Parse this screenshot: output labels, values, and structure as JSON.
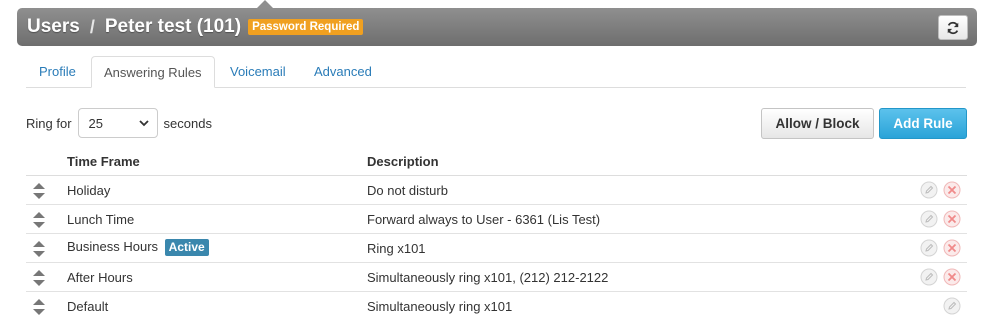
{
  "header": {
    "section": "Users",
    "separator": "/",
    "user_title": "Peter test (101)",
    "status_badge": "Password Required"
  },
  "tabs": [
    {
      "label": "Profile",
      "active": false
    },
    {
      "label": "Answering Rules",
      "active": true
    },
    {
      "label": "Voicemail",
      "active": false
    },
    {
      "label": "Advanced",
      "active": false
    }
  ],
  "ring_for": {
    "label": "Ring for",
    "value": "25",
    "suffix": "seconds"
  },
  "buttons": {
    "allow_block": "Allow / Block",
    "add_rule": "Add Rule"
  },
  "table": {
    "columns": [
      "Time Frame",
      "Description"
    ],
    "rows": [
      {
        "time_frame": "Holiday",
        "description": "Do not disturb",
        "active": false,
        "deletable": true
      },
      {
        "time_frame": "Lunch Time",
        "description": "Forward always to User - 6361 (Lis Test)",
        "active": false,
        "deletable": true
      },
      {
        "time_frame": "Business Hours",
        "description": "Ring x101",
        "active": true,
        "active_label": "Active",
        "deletable": true
      },
      {
        "time_frame": "After Hours",
        "description": "Simultaneously ring x101, (212) 212-2122",
        "active": false,
        "deletable": true
      },
      {
        "time_frame": "Default",
        "description": "Simultaneously ring x101",
        "active": false,
        "deletable": false
      }
    ]
  },
  "icons": {
    "refresh": "refresh-icon",
    "drag": "drag-handle-icon",
    "edit": "edit-icon",
    "delete": "delete-icon"
  },
  "colors": {
    "link": "#2a7cb8",
    "badge_warning": "#f0a020",
    "badge_active": "#3a87ad",
    "primary_button": "#2aa3d8"
  }
}
